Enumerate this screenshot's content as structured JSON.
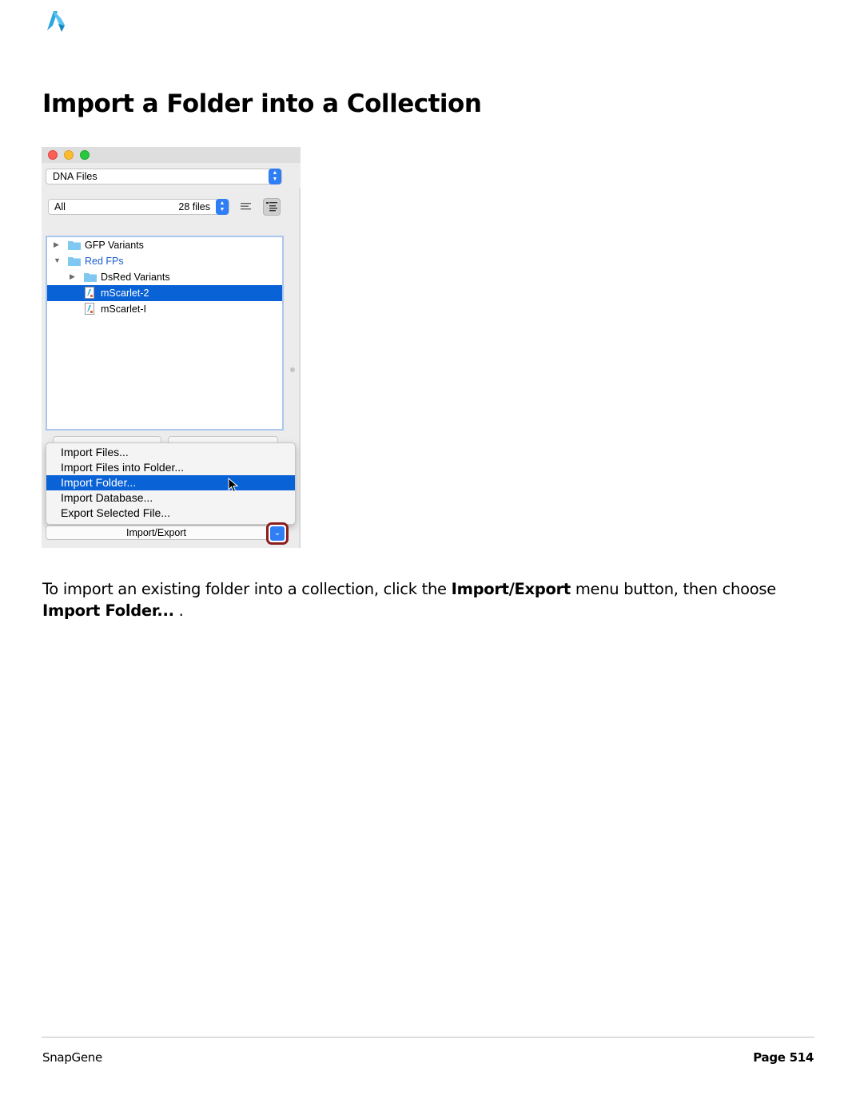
{
  "header": {
    "logo_icon": "snapgene-logo-icon",
    "title": "Import a Folder into a Collection"
  },
  "screenshot": {
    "file_type_select": "DNA Files",
    "filter_select": "All",
    "file_count": "28 files",
    "tree": [
      {
        "label": "GFP Variants",
        "type": "folder",
        "expanded": false,
        "level": 0
      },
      {
        "label": "Red FPs",
        "type": "folder",
        "expanded": true,
        "level": 0,
        "color": "#1a5fd1"
      },
      {
        "label": "DsRed Variants",
        "type": "folder",
        "expanded": false,
        "level": 1
      },
      {
        "label": "mScarlet-2",
        "type": "file",
        "level": 1,
        "selected": true
      },
      {
        "label": "mScarlet-I",
        "type": "file",
        "level": 1
      }
    ],
    "menu": {
      "items": [
        "Import Files...",
        "Import Files into Folder...",
        "Import Folder...",
        "Import Database...",
        "Export Selected File..."
      ],
      "highlighted": "Import Folder..."
    },
    "import_export_button": "Import/Export",
    "colors": {
      "selection": "#0a63d6",
      "accent": "#2f7ef6",
      "highlight_ring": "#8b1d1d"
    }
  },
  "description": {
    "part1": "To import an existing folder into a collection, click the ",
    "bold1": "Import/Export",
    "part2": " menu button, then choose ",
    "bold2": "Import Folder...",
    "part3": " ."
  },
  "footer": {
    "left": "SnapGene",
    "right": "Page 514"
  }
}
